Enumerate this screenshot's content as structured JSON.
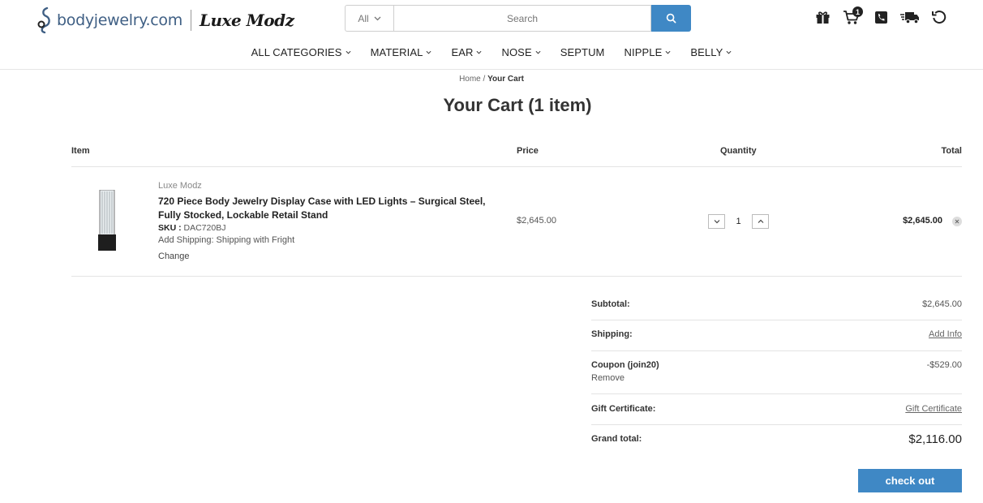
{
  "header": {
    "logo_text": "bodyjewelry.com",
    "logo_secondary": "Luxe Modz",
    "search": {
      "category": "All",
      "placeholder": "Search"
    },
    "cart_count": "1",
    "icons": [
      "gift-icon",
      "cart-icon",
      "phone-icon",
      "truck-icon",
      "history-icon"
    ]
  },
  "nav": {
    "items": [
      {
        "label": "ALL CATEGORIES",
        "dropdown": true
      },
      {
        "label": "MATERIAL",
        "dropdown": true
      },
      {
        "label": "EAR",
        "dropdown": true
      },
      {
        "label": "NOSE",
        "dropdown": true
      },
      {
        "label": "SEPTUM",
        "dropdown": false
      },
      {
        "label": "NIPPLE",
        "dropdown": true
      },
      {
        "label": "BELLY",
        "dropdown": true
      }
    ]
  },
  "breadcrumb": {
    "home": "Home",
    "separator": "/",
    "current": "Your Cart"
  },
  "page_title": "Your Cart (1 item)",
  "table": {
    "headers": {
      "item": "Item",
      "price": "Price",
      "quantity": "Quantity",
      "total": "Total"
    },
    "rows": [
      {
        "brand": "Luxe Modz",
        "name": "720 Piece Body Jewelry Display Case with LED Lights – Surgical Steel, Fully Stocked, Lockable Retail Stand",
        "sku_label": "SKU :",
        "sku": "DAC720BJ",
        "shipping": "Add Shipping: Shipping with Fright",
        "change_label": "Change",
        "price": "$2,645.00",
        "quantity": "1",
        "total": "$2,645.00"
      }
    ]
  },
  "summary": {
    "subtotal_label": "Subtotal:",
    "subtotal_value": "$2,645.00",
    "shipping_label": "Shipping:",
    "shipping_value": "Add Info",
    "coupon_label": "Coupon (join20)",
    "coupon_remove": "Remove",
    "coupon_value": "-$529.00",
    "gift_label": "Gift Certificate:",
    "gift_value": "Gift Certificate",
    "grand_label": "Grand total:",
    "grand_value": "$2,116.00",
    "checkout_label": "check out"
  },
  "colors": {
    "accent": "#3f88c5",
    "logo_blue": "#3f5f84"
  }
}
